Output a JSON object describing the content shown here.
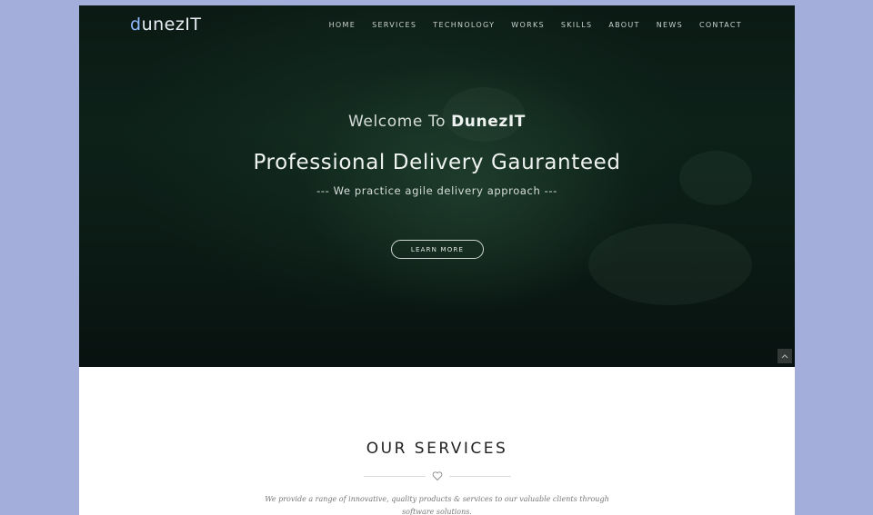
{
  "logo": {
    "prefix": "d",
    "rest": "unezIT"
  },
  "nav": {
    "items": [
      "HOME",
      "SERVICES",
      "TECHNOLOGY",
      "WORKS",
      "SKILLS",
      "ABOUT",
      "NEWS",
      "CONTACT"
    ]
  },
  "hero": {
    "welcome_prefix": "Welcome To ",
    "welcome_brand": "DunezIT",
    "headline": "Professional Delivery Gauranteed",
    "tagline": "--- We practice agile delivery approach ---",
    "cta_label": "LEARN MORE"
  },
  "services": {
    "title": "OUR SERVICES",
    "description": "We provide a range of innovative, quality products & services to our valuable clients through software solutions."
  },
  "colors": {
    "background": "#a3aedb",
    "hero_dark": "#0b1a14",
    "logo_accent": "#8fb8ff"
  }
}
